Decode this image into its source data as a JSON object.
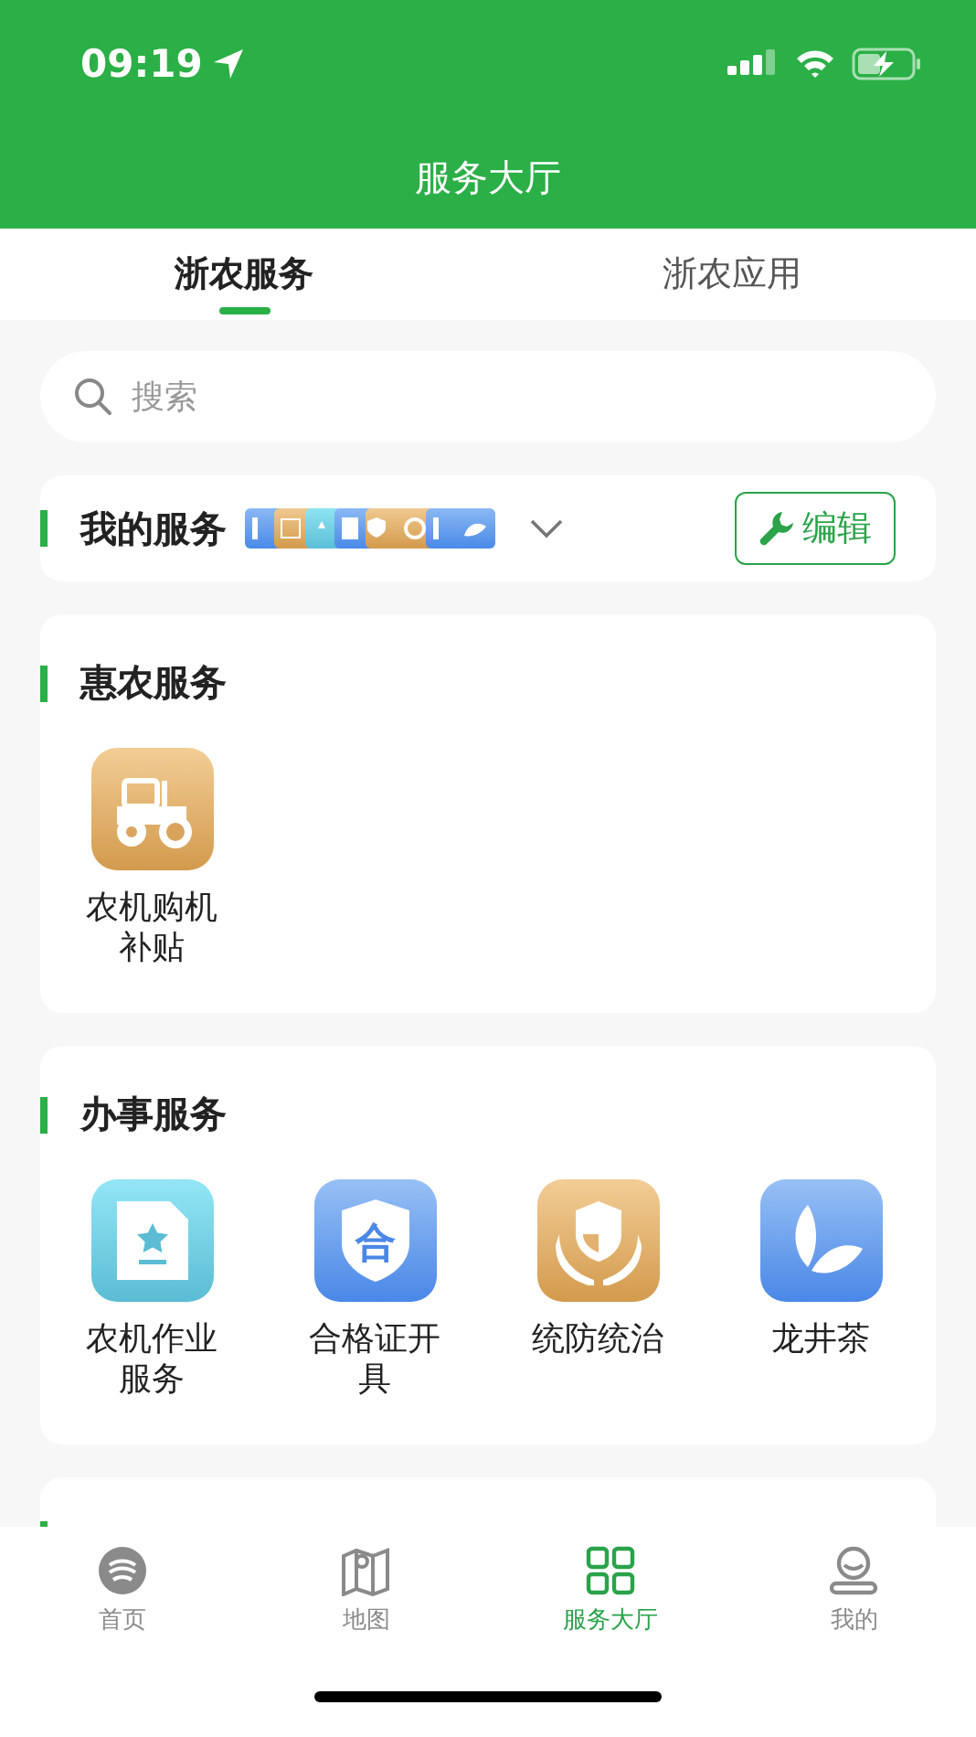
{
  "status_bar": {
    "time": "09:19"
  },
  "header": {
    "title": "服务大厅"
  },
  "tabs": [
    {
      "label": "浙农服务",
      "selected": true
    },
    {
      "label": "浙农应用",
      "selected": false
    }
  ],
  "search": {
    "placeholder": "搜索"
  },
  "my_services": {
    "title": "我的服务",
    "expanded": false,
    "edit_button": "编辑"
  },
  "sections": [
    {
      "title": "惠农服务",
      "items": [
        {
          "label": "农机购机补贴",
          "kind": "tractor"
        }
      ]
    },
    {
      "title": "办事服务",
      "items": [
        {
          "label": "农机作业服务",
          "kind": "document-star"
        },
        {
          "label": "合格证开具",
          "kind": "shield-glyph",
          "glyph": "合"
        },
        {
          "label": "统防统治",
          "kind": "shield-hands"
        },
        {
          "label": "龙井茶",
          "kind": "leaf"
        }
      ]
    },
    {
      "kind": "cut-off"
    }
  ],
  "bottom_nav": [
    {
      "label": "首页",
      "kind": "logo",
      "selected": false
    },
    {
      "label": "地图",
      "kind": "map",
      "selected": false
    },
    {
      "label": "服务大厅",
      "kind": "grid",
      "selected": true
    },
    {
      "label": "我的",
      "kind": "person",
      "selected": false
    }
  ]
}
